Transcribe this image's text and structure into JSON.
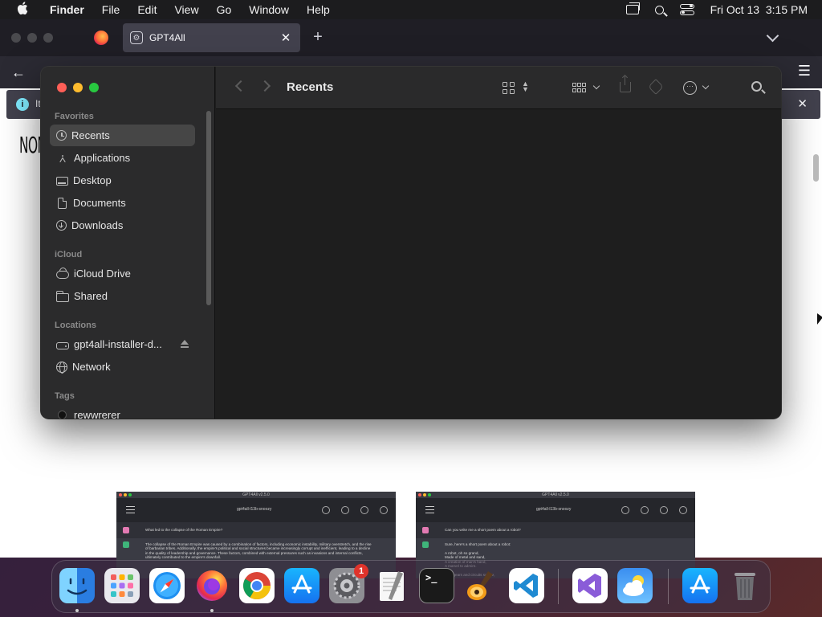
{
  "menubar": {
    "app_name": "Finder",
    "menus": [
      "File",
      "Edit",
      "View",
      "Go",
      "Window",
      "Help"
    ],
    "clock": "Fri Oct 13  3:15 PM",
    "icons": [
      "apple-icon",
      "display-icon",
      "search-icon",
      "control-center-icon"
    ]
  },
  "browser": {
    "tab_title": "GPT4All",
    "tab_close": "✕",
    "new_tab": "+",
    "back_glyph": "←",
    "menu_glyph": "☰",
    "info_icon": "i",
    "info_text": "It",
    "info_close": "✕",
    "page_logo": "NON",
    "screenshots": [
      {
        "window_title": "GPT4All v2.5.0",
        "model": "gpt4all-l13b-snoozy",
        "question": "What led to the collapse of the Roman Empire?",
        "answer": "The collapse of the Roman Empire was caused by a combination of factors, including economic instability, military overstretch, and the rise of barbarian tribes. Additionally, the empire's political and social structures became increasingly corrupt and inefficient, leading to a decline in the quality of leadership and governance. These factors, combined with external pressures such as invasions and internal conflicts, ultimately contributed to the empire's downfall."
      },
      {
        "window_title": "GPT4All v2.5.0",
        "model": "gpt4all-l13b-snoozy",
        "question": "Can you write me a short poem about a robot?",
        "answer": "Sure, here's a short poem about a robot:\n\nA robot, oh so grand,\nMade of metal and sand,\nA creation of man's hand,\nA marvel to admire.\n\nWith gears and circuits so fine,"
      }
    ]
  },
  "finder": {
    "title": "Recents",
    "sections": {
      "favorites": "Favorites",
      "icloud": "iCloud",
      "locations": "Locations",
      "tags": "Tags"
    },
    "favorites": [
      {
        "label": "Recents",
        "icon": "clock-icon"
      },
      {
        "label": "Applications",
        "icon": "applications-icon"
      },
      {
        "label": "Desktop",
        "icon": "desktop-icon"
      },
      {
        "label": "Documents",
        "icon": "document-icon"
      },
      {
        "label": "Downloads",
        "icon": "download-icon"
      }
    ],
    "icloud": [
      {
        "label": "iCloud Drive",
        "icon": "cloud-icon"
      },
      {
        "label": "Shared",
        "icon": "shared-folder-icon"
      }
    ],
    "locations": [
      {
        "label": "gpt4all-installer-d...",
        "icon": "drive-icon"
      },
      {
        "label": "Network",
        "icon": "globe-icon"
      }
    ],
    "tags": [
      {
        "label": "rewwrerer",
        "icon": "tag-dot-icon"
      }
    ],
    "more_glyph": "···",
    "colors": {
      "close": "#ff5f57",
      "minimize": "#febc2e",
      "zoom": "#28c840"
    }
  },
  "dock": {
    "apps": [
      "Finder",
      "Launchpad",
      "Safari",
      "Firefox",
      "Chrome",
      "App Store",
      "System Settings",
      "TextEdit",
      "Terminal",
      "GarageBand",
      "Visual Studio Code",
      "Visual Studio",
      "Weather",
      "App Store",
      "Trash"
    ],
    "settings_badge": "1",
    "terminal_prompt": ">_"
  }
}
